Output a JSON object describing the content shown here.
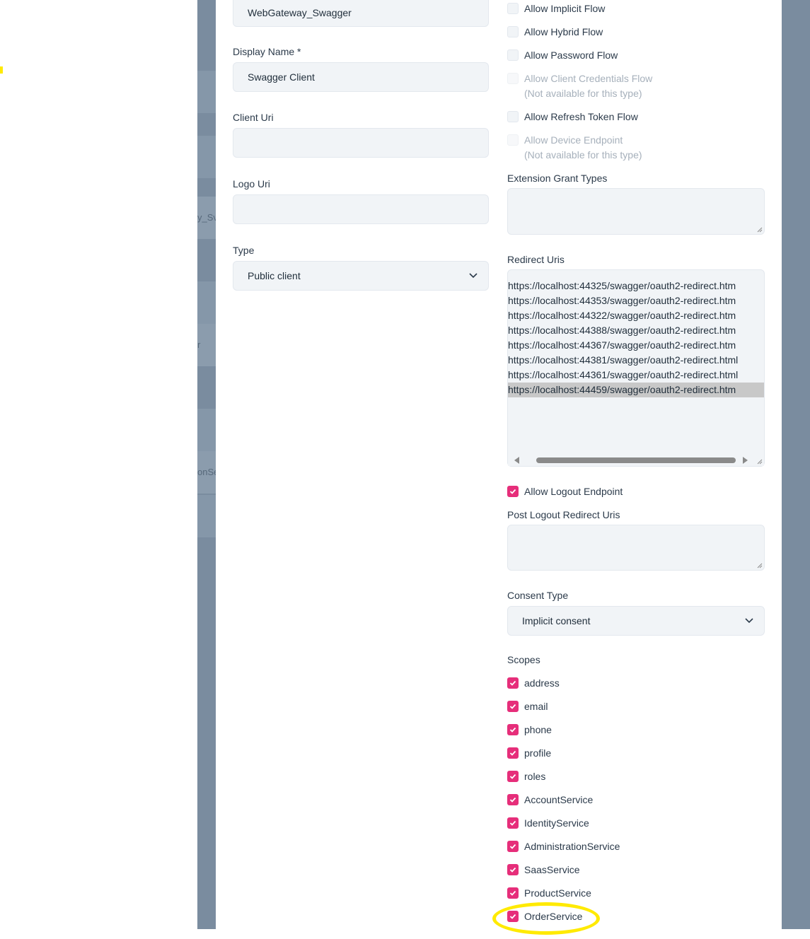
{
  "background": {
    "fragments": [
      "y_Sv",
      "r",
      "onSe"
    ]
  },
  "form": {
    "client_id_value": "WebGateway_Swagger",
    "display_name": {
      "label": "Display Name *",
      "value": "Swagger Client"
    },
    "client_uri": {
      "label": "Client Uri",
      "value": ""
    },
    "logo_uri": {
      "label": "Logo Uri",
      "value": ""
    },
    "type": {
      "label": "Type",
      "selected": "Public client"
    }
  },
  "flows": {
    "implicit": {
      "label": "Allow Implicit Flow",
      "checked": false
    },
    "hybrid": {
      "label": "Allow Hybrid Flow",
      "checked": false
    },
    "password": {
      "label": "Allow Password Flow",
      "checked": false
    },
    "client_credentials": {
      "label": "Allow Client Credentials Flow",
      "note": "(Not available for this type)",
      "disabled": true
    },
    "refresh_token": {
      "label": "Allow Refresh Token Flow",
      "checked": false
    },
    "device_endpoint": {
      "label": "Allow Device Endpoint",
      "note": "(Not available for this type)",
      "disabled": true
    }
  },
  "extension_grant_types": {
    "label": "Extension Grant Types",
    "value": ""
  },
  "redirect_uris": {
    "label": "Redirect Uris",
    "items": [
      "https://localhost:44325/swagger/oauth2-redirect.htm",
      "https://localhost:44353/swagger/oauth2-redirect.htm",
      "https://localhost:44322/swagger/oauth2-redirect.htm",
      "https://localhost:44388/swagger/oauth2-redirect.htm",
      "https://localhost:44367/swagger/oauth2-redirect.htm",
      "https://localhost:44381/swagger/oauth2-redirect.html",
      "https://localhost:44361/swagger/oauth2-redirect.html",
      "https://localhost:44459/swagger/oauth2-redirect.htm"
    ],
    "selected_index": 7
  },
  "logout": {
    "allow_label": "Allow Logout Endpoint",
    "allow_checked": true,
    "post_logout_label": "Post Logout Redirect Uris",
    "post_logout_value": ""
  },
  "consent": {
    "label": "Consent Type",
    "selected": "Implicit consent"
  },
  "scopes": {
    "label": "Scopes",
    "items": [
      "address",
      "email",
      "phone",
      "profile",
      "roles",
      "AccountService",
      "IdentityService",
      "AdministrationService",
      "SaasService",
      "ProductService",
      "OrderService"
    ],
    "all_checked": true
  },
  "colors": {
    "accent": "#e62e7a",
    "annotation": "#ffea00",
    "backdrop": "#7a8c9f"
  }
}
